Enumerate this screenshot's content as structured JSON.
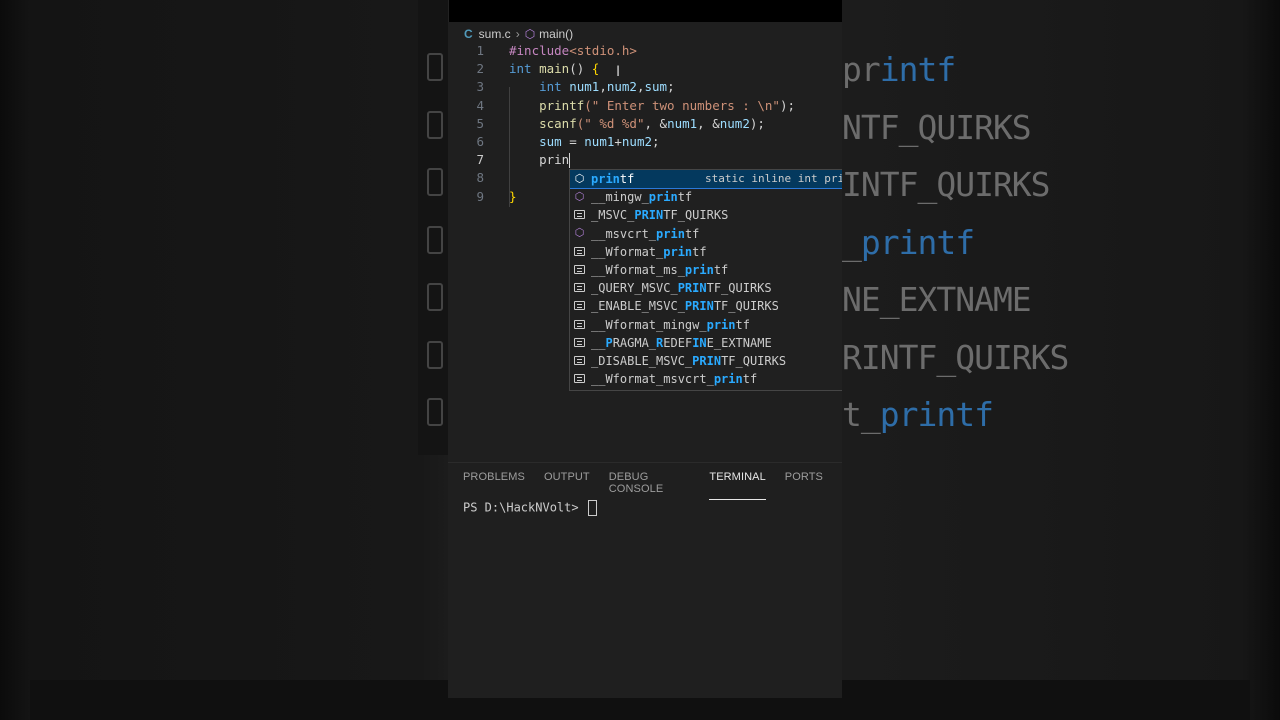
{
  "breadcrumb": {
    "file_icon": "C",
    "file": "sum.c",
    "symbol_icon": "symbol-method-icon",
    "symbol": "main()"
  },
  "code_lines": [
    {
      "num": "1",
      "parts": [
        [
          "pp",
          "#include"
        ],
        [
          "str",
          "<stdio.h>"
        ]
      ]
    },
    {
      "num": "2",
      "parts": [
        [
          "kw",
          "int"
        ],
        [
          "op",
          " "
        ],
        [
          "fn",
          "main"
        ],
        [
          "op",
          "() "
        ],
        [
          "brace",
          "{"
        ]
      ]
    },
    {
      "num": "3",
      "parts": [
        [
          "op",
          "    "
        ],
        [
          "kw",
          "int"
        ],
        [
          "op",
          " "
        ],
        [
          "var",
          "num1"
        ],
        [
          "op",
          ","
        ],
        [
          "var",
          "num2"
        ],
        [
          "op",
          ","
        ],
        [
          "var",
          "sum"
        ],
        [
          "op",
          ";"
        ]
      ]
    },
    {
      "num": "4",
      "parts": [
        [
          "op",
          "    "
        ],
        [
          "fn",
          "printf"
        ],
        [
          "str",
          "(\" Enter two numbers : \\n\""
        ],
        [
          "op",
          ");"
        ]
      ]
    },
    {
      "num": "5",
      "parts": [
        [
          "op",
          "    "
        ],
        [
          "fn",
          "scanf"
        ],
        [
          "str",
          "(\" %d %d\""
        ],
        [
          "op",
          ", &"
        ],
        [
          "var",
          "num1"
        ],
        [
          "op",
          ", &"
        ],
        [
          "var",
          "num2"
        ],
        [
          "op",
          ");"
        ]
      ]
    },
    {
      "num": "6",
      "parts": [
        [
          "op",
          "    "
        ],
        [
          "var",
          "sum"
        ],
        [
          "op",
          " = "
        ],
        [
          "var",
          "num1"
        ],
        [
          "op",
          "+"
        ],
        [
          "var",
          "num2"
        ],
        [
          "op",
          ";"
        ]
      ]
    },
    {
      "num": "7",
      "parts": [
        [
          "op",
          "    "
        ],
        [
          "op",
          "prin"
        ]
      ],
      "active": true,
      "cursor": true
    },
    {
      "num": "8",
      "parts": []
    },
    {
      "num": "9",
      "parts": [
        [
          "brace",
          "}"
        ]
      ]
    }
  ],
  "suggestions": [
    {
      "icon": "method-cube-icon",
      "pre": "",
      "match": "prin",
      "post": "tf",
      "detail": "static inline int prin",
      "selected": true
    },
    {
      "icon": "method-cube-icon",
      "pre": "__mingw_",
      "match": "prin",
      "post": "tf"
    },
    {
      "icon": "constant-icon",
      "pre": "_MSVC_",
      "match": "PRIN",
      "post": "TF_QUIRKS"
    },
    {
      "icon": "method-cube-icon",
      "pre": "__msvcrt_",
      "match": "prin",
      "post": "tf"
    },
    {
      "icon": "constant-icon",
      "pre": "__Wformat_",
      "match": "prin",
      "post": "tf"
    },
    {
      "icon": "constant-icon",
      "pre": "__Wformat_ms_",
      "match": "prin",
      "post": "tf"
    },
    {
      "icon": "constant-icon",
      "pre": "_QUERY_MSVC_",
      "match": "PRIN",
      "post": "TF_QUIRKS"
    },
    {
      "icon": "constant-icon",
      "pre": "_ENABLE_MSVC_",
      "match": "PRIN",
      "post": "TF_QUIRKS"
    },
    {
      "icon": "constant-icon",
      "pre": "__Wformat_mingw_",
      "match": "prin",
      "post": "tf"
    },
    {
      "icon": "constant-icon",
      "segments": [
        [
          "",
          "__"
        ],
        [
          "m",
          "P"
        ],
        [
          "",
          "RAGMA_"
        ],
        [
          "m",
          "R"
        ],
        [
          "",
          "EDEF"
        ],
        [
          "m",
          "IN"
        ],
        [
          "",
          "E_EXTNAME"
        ]
      ]
    },
    {
      "icon": "constant-icon",
      "pre": "_DISABLE_MSVC_",
      "match": "PRIN",
      "post": "TF_QUIRKS"
    },
    {
      "icon": "constant-icon",
      "pre": "__Wformat_msvcrt_",
      "match": "prin",
      "post": "tf"
    }
  ],
  "panel": {
    "tabs": [
      {
        "label": "PROBLEMS",
        "active": false
      },
      {
        "label": "OUTPUT",
        "active": false
      },
      {
        "label": "DEBUG CONSOLE",
        "active": false
      },
      {
        "label": "TERMINAL",
        "active": true
      },
      {
        "label": "PORTS",
        "active": false
      }
    ],
    "terminal_prompt": "PS D:\\HackNVolt> "
  },
  "background_ghost": [
    {
      "text": "printf",
      "hl": "intf"
    },
    {
      "text": "NTF_QUIRKS",
      "hl": ""
    },
    {
      "text": "INTF_QUIRKS",
      "hl": ""
    },
    {
      "text": "_printf",
      "hl": "printf"
    },
    {
      "text": "NE_EXTNAME",
      "hl": ""
    },
    {
      "text": "RINTF_QUIRKS",
      "hl": ""
    },
    {
      "text": "t_printf",
      "hl": "printf"
    }
  ]
}
